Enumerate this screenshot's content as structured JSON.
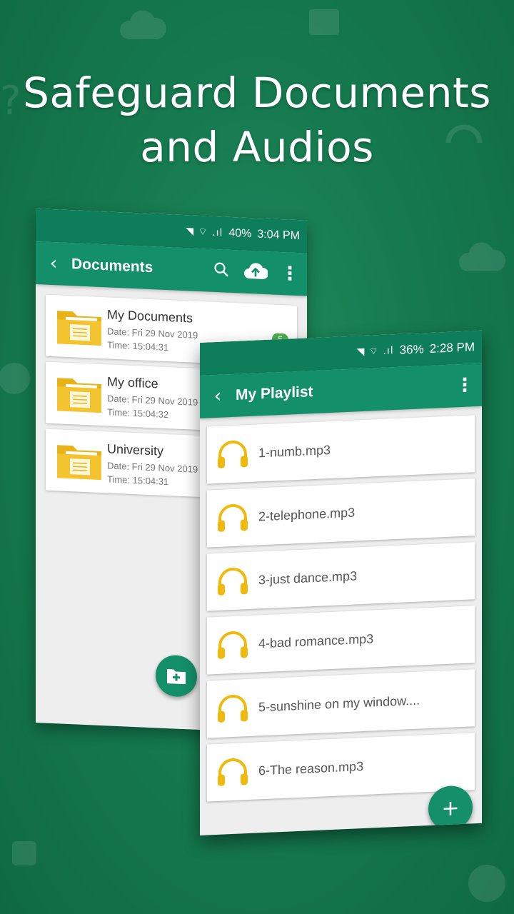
{
  "headline": {
    "line1": "Safeguard Documents",
    "line2": "and Audios"
  },
  "documents_screen": {
    "status": {
      "signal": "◥ ⌔ .ıl",
      "battery": "40%",
      "time": "3:04 PM"
    },
    "title": "Documents",
    "back_icon": "‹",
    "search_icon": "⌕",
    "more_icon": "⋮",
    "folders": [
      {
        "name": "My Documents",
        "date": "Date: Fri 29 Nov 2019",
        "time": "Time: 15:04:31",
        "badge": "5"
      },
      {
        "name": "My office",
        "date": "Date: Fri 29 Nov 2019",
        "time": "Time: 15:04:32"
      },
      {
        "name": "University",
        "date": "Date: Fri 29 Nov 2019",
        "time": "Time: 15:04:31"
      }
    ]
  },
  "playlist_screen": {
    "status": {
      "signal": "◥ ⌔ .ıl",
      "battery": "36%",
      "time": "2:28 PM"
    },
    "title": "My Playlist",
    "back_icon": "‹",
    "more_icon": "⋮",
    "tracks": [
      "1-numb.mp3",
      "2-telephone.mp3",
      "3-just dance.mp3",
      "4-bad romance.mp3",
      "5-sunshine on my window....",
      "6-The reason.mp3"
    ],
    "fab_label": "+"
  },
  "colors": {
    "primary": "#138f69",
    "status": "#0e7d5a",
    "folder": "#f2c02a",
    "headphone": "#f0b90b",
    "background": "#167a50"
  }
}
